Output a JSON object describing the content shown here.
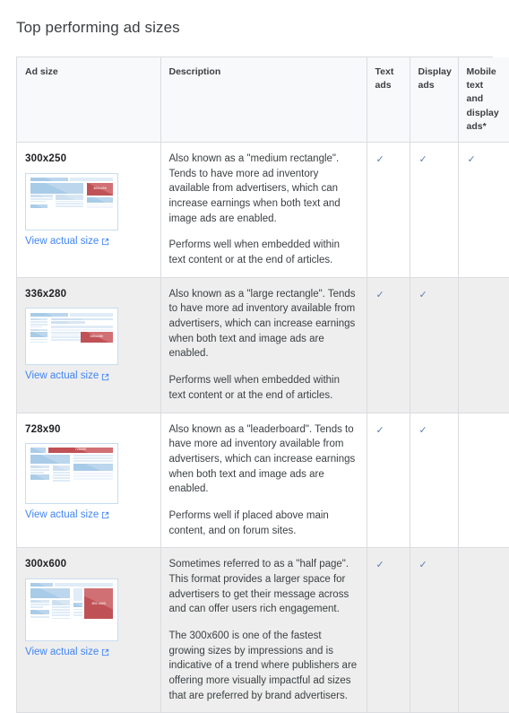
{
  "page": {
    "title": "Top performing ad sizes"
  },
  "table": {
    "columns": [
      {
        "key": "ad_size",
        "label": "Ad size"
      },
      {
        "key": "description",
        "label": "Description"
      },
      {
        "key": "text_ads",
        "label": "Text ads"
      },
      {
        "key": "display_ads",
        "label": "Display ads"
      },
      {
        "key": "mobile_text_and_display_ads",
        "label": "Mobile text and display ads*"
      }
    ],
    "link_label": "View actual size",
    "link_icon": "external-link-icon",
    "check_mark": "✓",
    "rows": [
      {
        "ad_size": "300x250",
        "thumb_label": "300x250",
        "thumb_variant": "medium-rectangle",
        "description": [
          "Also known as a \"medium rectangle\". Tends to have more ad inventory available from advertisers, which can increase earnings when both text and image ads are enabled.",
          "Performs well when embedded within text content or at the end of articles."
        ],
        "text_ads": true,
        "display_ads": true,
        "mobile_text_and_display_ads": true,
        "shaded": false
      },
      {
        "ad_size": "336x280",
        "thumb_label": "336x280",
        "thumb_variant": "large-rectangle",
        "description": [
          "Also known as a \"large rectangle\". Tends to have more ad inventory available from advertisers, which can increase earnings when both text and image ads are enabled.",
          "Performs well when embedded within text content or at the end of articles."
        ],
        "text_ads": true,
        "display_ads": true,
        "mobile_text_and_display_ads": false,
        "shaded": true
      },
      {
        "ad_size": "728x90",
        "thumb_label": "728x90",
        "thumb_variant": "leaderboard",
        "description": [
          "Also known as a \"leaderboard\". Tends to have more ad inventory available from advertisers, which can increase earnings when both text and image ads are enabled.",
          "Performs well if placed above main content, and on forum sites."
        ],
        "text_ads": true,
        "display_ads": true,
        "mobile_text_and_display_ads": false,
        "shaded": false
      },
      {
        "ad_size": "300x600",
        "thumb_label": "300 x600",
        "thumb_variant": "half-page",
        "description": [
          "Sometimes referred to as a \"half page\". This format provides a larger space for advertisers to get their message across and can offer users rich engagement.",
          "The 300x600 is one of the fastest growing sizes by impressions and is indicative of a trend where publishers are offering more visually impactful ad sizes that are preferred by brand advertisers."
        ],
        "text_ads": true,
        "display_ads": true,
        "mobile_text_and_display_ads": false,
        "shaded": true
      }
    ]
  },
  "colors": {
    "link": "#4285f4",
    "check": "#5b7fb5",
    "ad_block": "#c8555a",
    "header_bg": "#f8f9fa",
    "row_alt_bg": "#eeeeee",
    "border": "#dadce0"
  }
}
